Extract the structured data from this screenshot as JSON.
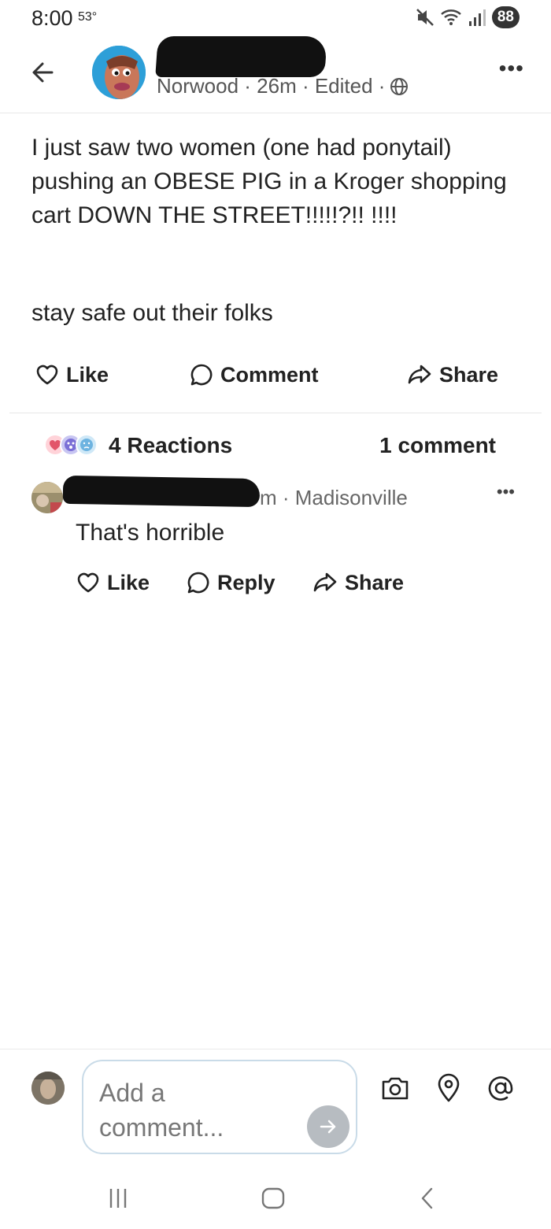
{
  "status_bar": {
    "time": "8:00",
    "temperature": "53°",
    "battery": "88"
  },
  "post": {
    "author_meta": "Norwood · 26m · Edited ·",
    "body": "I just saw two women (one had ponytail) pushing an OBESE PIG in a Kroger shopping cart DOWN THE STREET!!!!!?!! !!!!",
    "footer": "stay safe out their folks",
    "actions": {
      "like": "Like",
      "comment": "Comment",
      "share": "Share"
    },
    "reactions": "4 Reactions",
    "comments": "1 comment"
  },
  "comment": {
    "location": "m · Madisonville",
    "text": "That's horrible",
    "actions": {
      "like": "Like",
      "reply": "Reply",
      "share": "Share"
    }
  },
  "composer": {
    "placeholder": "Add a comment..."
  },
  "colors": {
    "text": "#222222",
    "muted": "#555555",
    "send_button": "#b7bcc1",
    "input_border": "#c9dbe8"
  }
}
